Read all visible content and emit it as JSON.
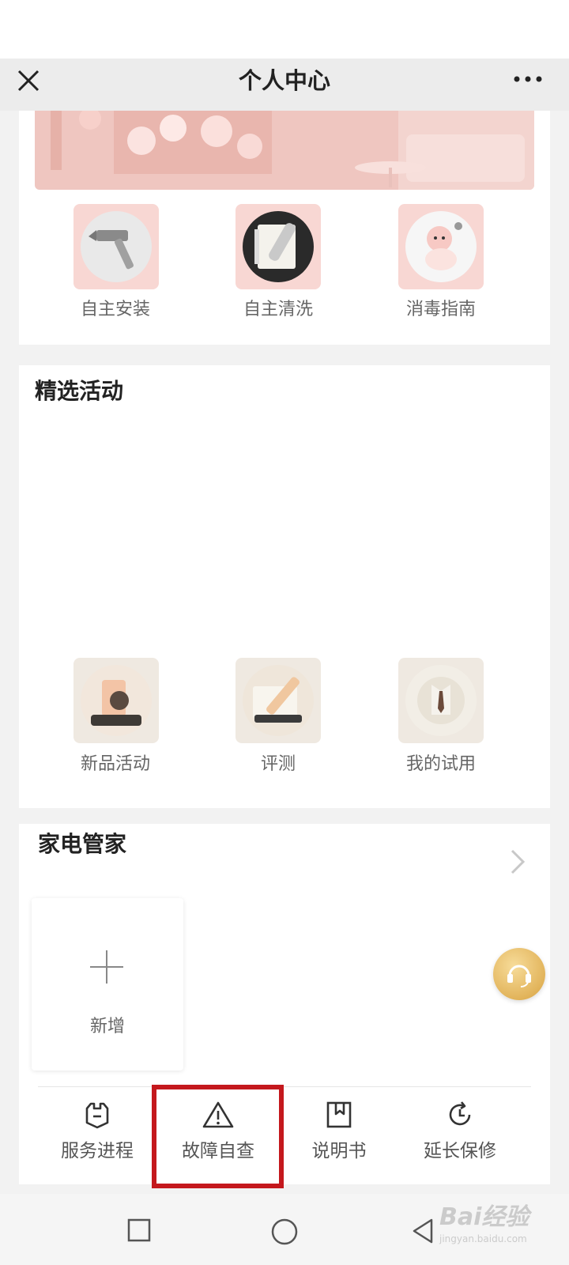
{
  "header": {
    "title": "个人中心"
  },
  "services": [
    {
      "label": "自主安装",
      "icon": "hammer-icon"
    },
    {
      "label": "自主清洗",
      "icon": "notebook-pencil-icon"
    },
    {
      "label": "消毒指南",
      "icon": "baby-doll-icon"
    }
  ],
  "activities": {
    "title": "精选活动",
    "items": [
      {
        "label": "新品活动",
        "icon": "product-icon"
      },
      {
        "label": "评测",
        "icon": "pen-note-icon"
      },
      {
        "label": "我的试用",
        "icon": "shirt-tie-icon"
      }
    ]
  },
  "appliance": {
    "title": "家电管家",
    "add_label": "新增"
  },
  "tools": [
    {
      "label": "服务进程",
      "icon": "wrench-shield-icon"
    },
    {
      "label": "故障自查",
      "icon": "warning-triangle-icon"
    },
    {
      "label": "说明书",
      "icon": "manual-icon"
    },
    {
      "label": "延长保修",
      "icon": "clock-refresh-icon"
    }
  ],
  "watermark": {
    "text": "Bai经验",
    "sub": "jingyan.baidu.com"
  },
  "colors": {
    "highlight": "#c4181d",
    "accent_gold": "#e2b45b",
    "tile_pink": "#f8d7d3"
  }
}
